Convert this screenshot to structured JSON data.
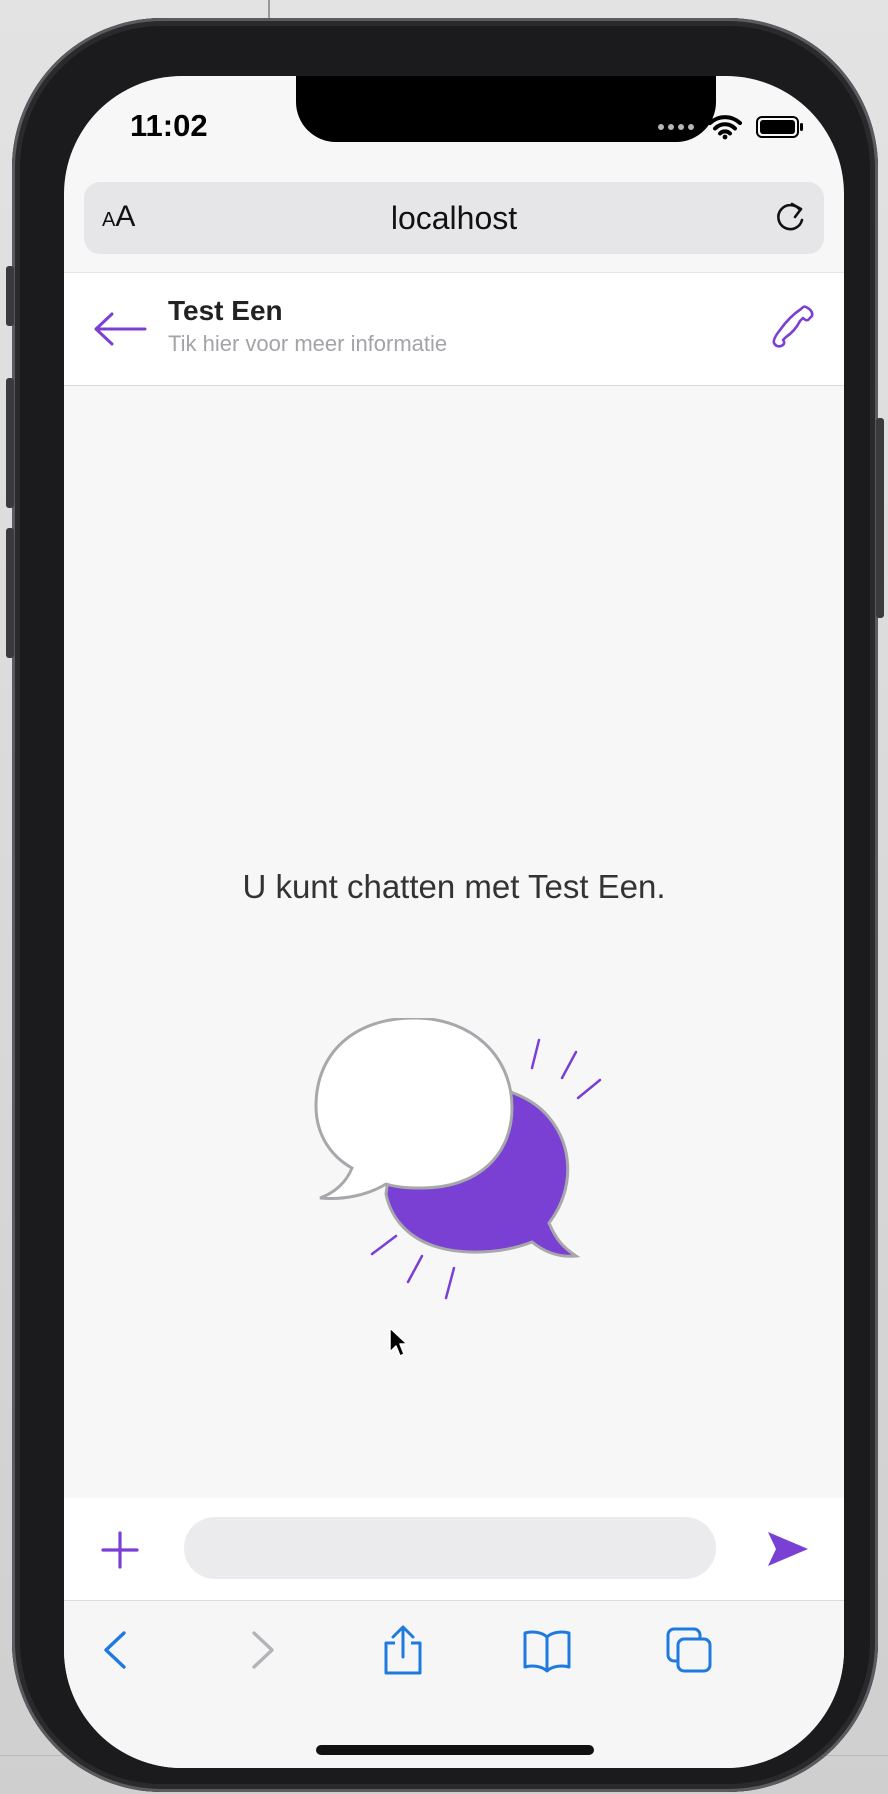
{
  "status": {
    "time": "11:02"
  },
  "browser": {
    "text_size_small": "A",
    "text_size_large": "A",
    "url": "localhost"
  },
  "chat_header": {
    "name": "Test Een",
    "subtitle": "Tik hier voor meer informatie"
  },
  "chat_body": {
    "empty_message": "U kunt chatten met Test Een."
  },
  "composer": {
    "input_value": "",
    "input_placeholder": ""
  },
  "colors": {
    "accent": "#7a3fd3",
    "ios_blue": "#1f7ae0",
    "disabled": "#b4b4b8"
  },
  "icons": {
    "back": "left-arrow-icon",
    "call": "phone-icon",
    "add": "plus-icon",
    "send": "send-icon",
    "reload": "reload-icon",
    "safari_back": "chevron-left-icon",
    "safari_forward": "chevron-right-icon",
    "share": "share-icon",
    "bookmarks": "book-icon",
    "tabs": "tabs-icon"
  }
}
